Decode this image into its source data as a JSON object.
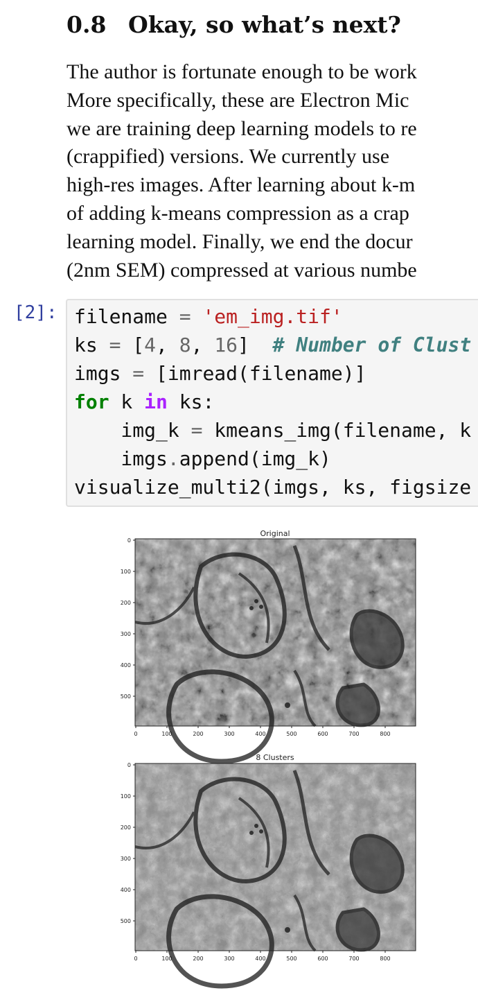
{
  "section": {
    "number": "0.8",
    "title": "Okay, so what’s next?"
  },
  "paragraph": [
    "The author is fortunate enough to be work",
    "More specifically, these are Electron Mic",
    "we are training deep learning models to re",
    "(crappified) versions.  We currently use ",
    "high-res images. After learning about k-m",
    "of adding k-means compression as a crap",
    "learning model. Finally, we end the docur",
    "(2nm SEM) compressed at various numbe"
  ],
  "cell": {
    "prompt": "[2]:",
    "code": {
      "l1_var": "filename",
      "l1_op": " = ",
      "l1_str": "'em_img.tif'",
      "l2_a": "ks ",
      "l2_op": "=",
      "l2_b": " [",
      "l2_n1": "4",
      "l2_c1": ", ",
      "l2_n2": "8",
      "l2_c2": ", ",
      "l2_n3": "16",
      "l2_c3": "]  ",
      "l2_comment": "# Number of Clust",
      "l3_a": "imgs ",
      "l3_op": "=",
      "l3_b": " [imread(filename)]",
      "l4_kw": "for",
      "l4_a": " k ",
      "l4_kw2": "in",
      "l4_b": " ks:",
      "l5_a": "    img_k ",
      "l5_op": "=",
      "l5_b": " kmeans_img(filename, k",
      "l6_a": "    imgs",
      "l6_op": ".",
      "l6_b": "append(img_k)",
      "l7": "visualize_multi2(imgs, ks, figsize"
    }
  },
  "figures": [
    {
      "title": "Original"
    },
    {
      "title": "8 Clusters"
    }
  ],
  "axes": {
    "y_ticks": [
      "0",
      "100",
      "200",
      "300",
      "400",
      "500"
    ],
    "x_ticks": [
      "0",
      "100",
      "200",
      "300",
      "400",
      "500",
      "600",
      "700",
      "800"
    ]
  }
}
